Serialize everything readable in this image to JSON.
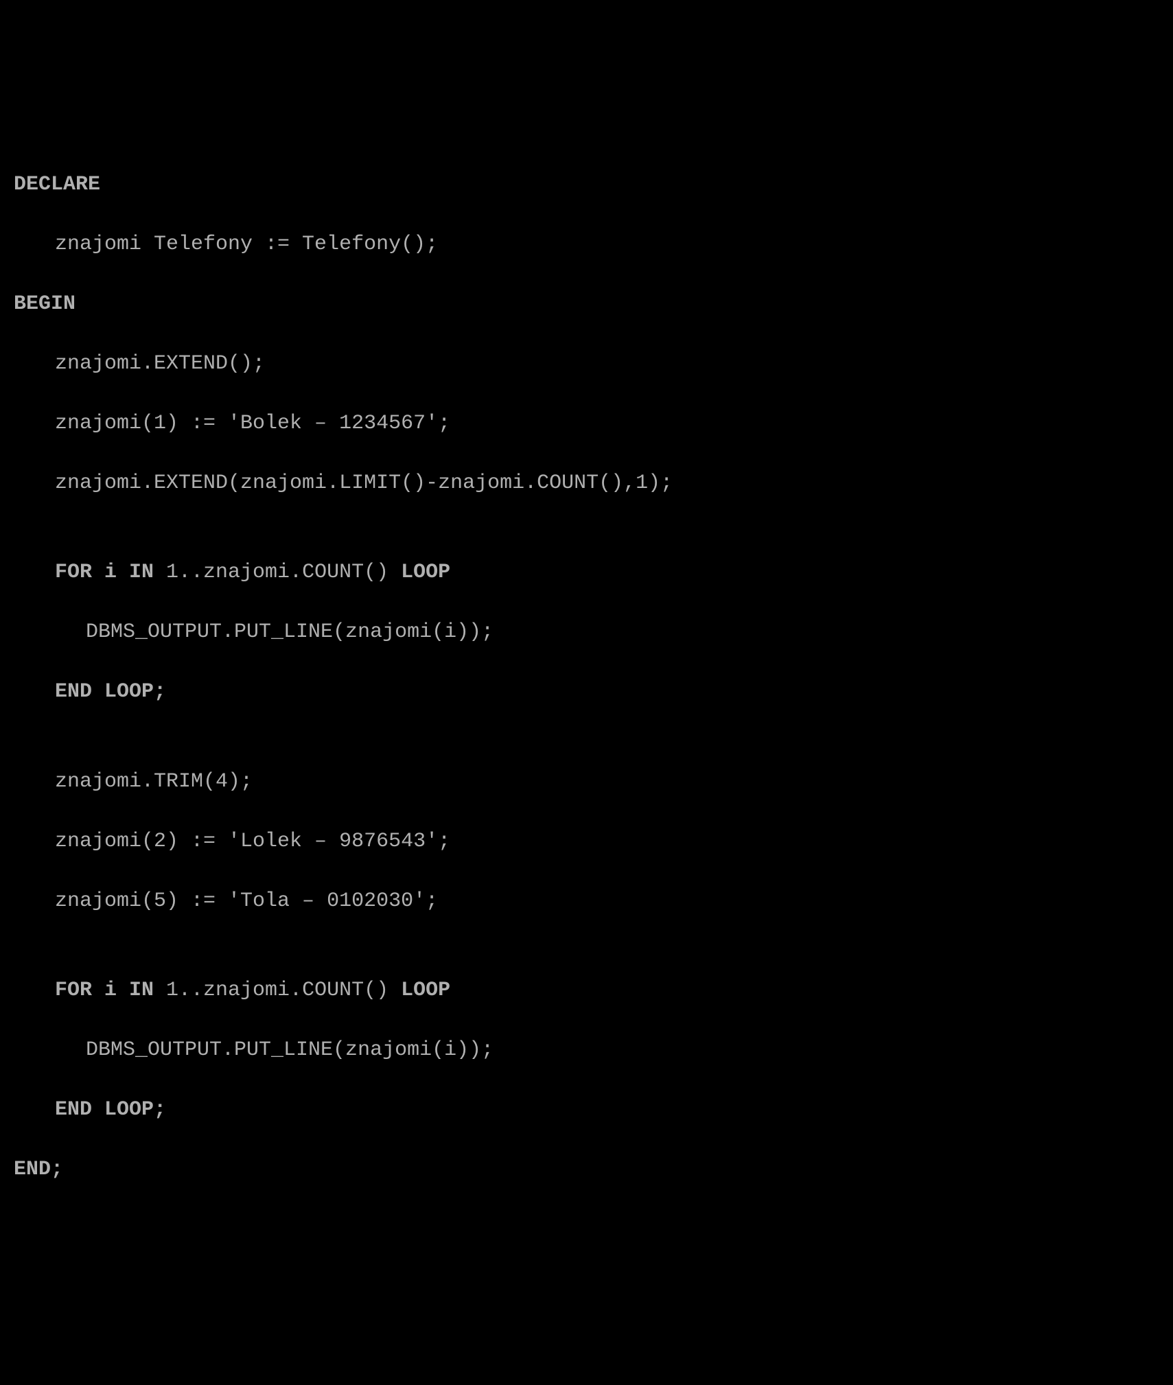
{
  "code": {
    "l1": "DECLARE",
    "l2": "znajomi Telefony := Telefony();",
    "l3": "BEGIN",
    "l4": "znajomi.EXTEND();",
    "l5": "znajomi(1) := 'Bolek – 1234567';",
    "l6": "znajomi.EXTEND(znajomi.LIMIT()-znajomi.COUNT(),1);",
    "l7": "",
    "l8a": "FOR i IN ",
    "l8b": "1..znajomi.COUNT()",
    "l8c": " LOOP",
    "l9": "DBMS_OUTPUT.PUT_LINE(znajomi(i));",
    "l10": "END LOOP;",
    "l11": "",
    "l12": "znajomi.TRIM(4);",
    "l13": "znajomi(2) := 'Lolek – 9876543';",
    "l14": "znajomi(5) := 'Tola – 0102030';",
    "l15": "",
    "l16a": "FOR i IN ",
    "l16b": "1..znajomi.COUNT()",
    "l16c": " LOOP",
    "l17": "DBMS_OUTPUT.PUT_LINE(znajomi(i));",
    "l18": "END LOOP;",
    "l19": "END;"
  }
}
